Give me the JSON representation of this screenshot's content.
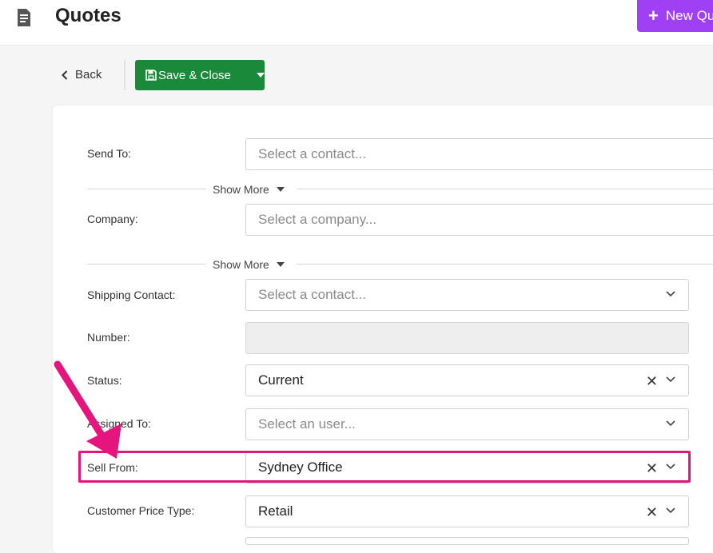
{
  "header": {
    "title": "Quotes",
    "new_button_label": "New Quo",
    "accent_color": "#a040f4"
  },
  "toolbar": {
    "back_label": "Back",
    "save_label": "Save & Close",
    "save_color": "#1a8a3a"
  },
  "form": {
    "send_to": {
      "label": "Send To:",
      "placeholder": "Select a contact..."
    },
    "show_more_1": "Show More",
    "company": {
      "label": "Company:",
      "placeholder": "Select a company..."
    },
    "show_more_2": "Show More",
    "shipping_contact": {
      "label": "Shipping Contact:",
      "placeholder": "Select a contact..."
    },
    "number": {
      "label": "Number:",
      "value": ""
    },
    "status": {
      "label": "Status:",
      "value": "Current"
    },
    "assigned_to": {
      "label": "Assigned To:",
      "placeholder": "Select an user..."
    },
    "sell_from": {
      "label": "Sell From:",
      "value": "Sydney Office"
    },
    "customer_price_type": {
      "label": "Customer Price Type:",
      "value": "Retail"
    }
  },
  "annotation": {
    "highlight_color": "#e4157d"
  }
}
